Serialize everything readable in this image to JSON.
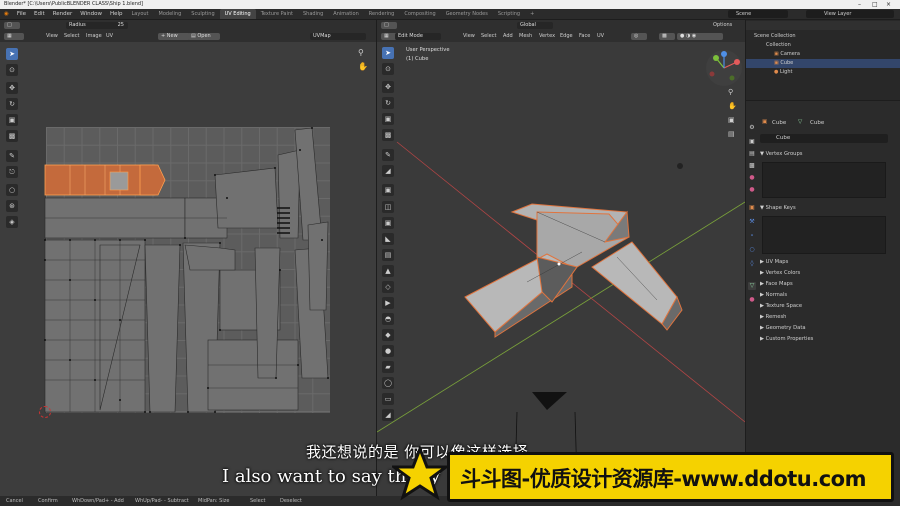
{
  "window": {
    "title": "Blender* [C:\\Users\\PublicBLENDER CLASS\\Ship 1.blend]"
  },
  "menu": [
    "File",
    "Edit",
    "Render",
    "Window",
    "Help"
  ],
  "workspaces": [
    "Layout",
    "Modeling",
    "Sculpting",
    "UV Editing",
    "Texture Paint",
    "Shading",
    "Animation",
    "Rendering",
    "Compositing",
    "Geometry Nodes",
    "Scripting"
  ],
  "active_workspace": "UV Editing",
  "scene": {
    "label": "Scene",
    "view_layer": "View Layer"
  },
  "uv_editor": {
    "header": {
      "brush": "Radius",
      "brush_value": "25"
    },
    "menu": [
      "View",
      "Select",
      "Image",
      "UV"
    ],
    "new_label": "New",
    "open_label": "Open",
    "uvmap": "UVMap"
  },
  "viewport": {
    "mode": "Edit Mode",
    "menu": [
      "View",
      "Select",
      "Add",
      "Mesh",
      "Vertex",
      "Edge",
      "Face",
      "UV"
    ],
    "orientation": "Global",
    "options": "Options",
    "perspective": "User Perspective",
    "object": "(1) Cube"
  },
  "outliner": {
    "items": [
      {
        "label": "Scene Collection"
      },
      {
        "label": "Collection"
      },
      {
        "label": "Camera"
      },
      {
        "label": "Cube"
      },
      {
        "label": "Light"
      }
    ]
  },
  "properties": {
    "object": "Cube",
    "mesh": "Cube",
    "data_name": "Cube",
    "sections": [
      "Vertex Groups",
      "Shape Keys",
      "UV Maps",
      "Vertex Colors",
      "Face Maps",
      "Normals",
      "Texture Space",
      "Remesh",
      "Geometry Data",
      "Custom Properties"
    ]
  },
  "status": {
    "items": [
      "Cancel",
      "Confirm",
      "WhDown/Pad+ - Add",
      "WhUp/Pad- - Subtract",
      "MidPan: Size",
      "Select",
      "Deselect"
    ]
  },
  "subtitles": {
    "cn": "我还想说的是 你可以像这样选择",
    "en": "I also want to say that y"
  },
  "banner": {
    "text": "斗斗图-优质设计资源库-www.ddotu.com"
  },
  "colors": {
    "accent": "#4772b3",
    "uv_island": "#c46a3c",
    "banner": "#f5d200"
  }
}
